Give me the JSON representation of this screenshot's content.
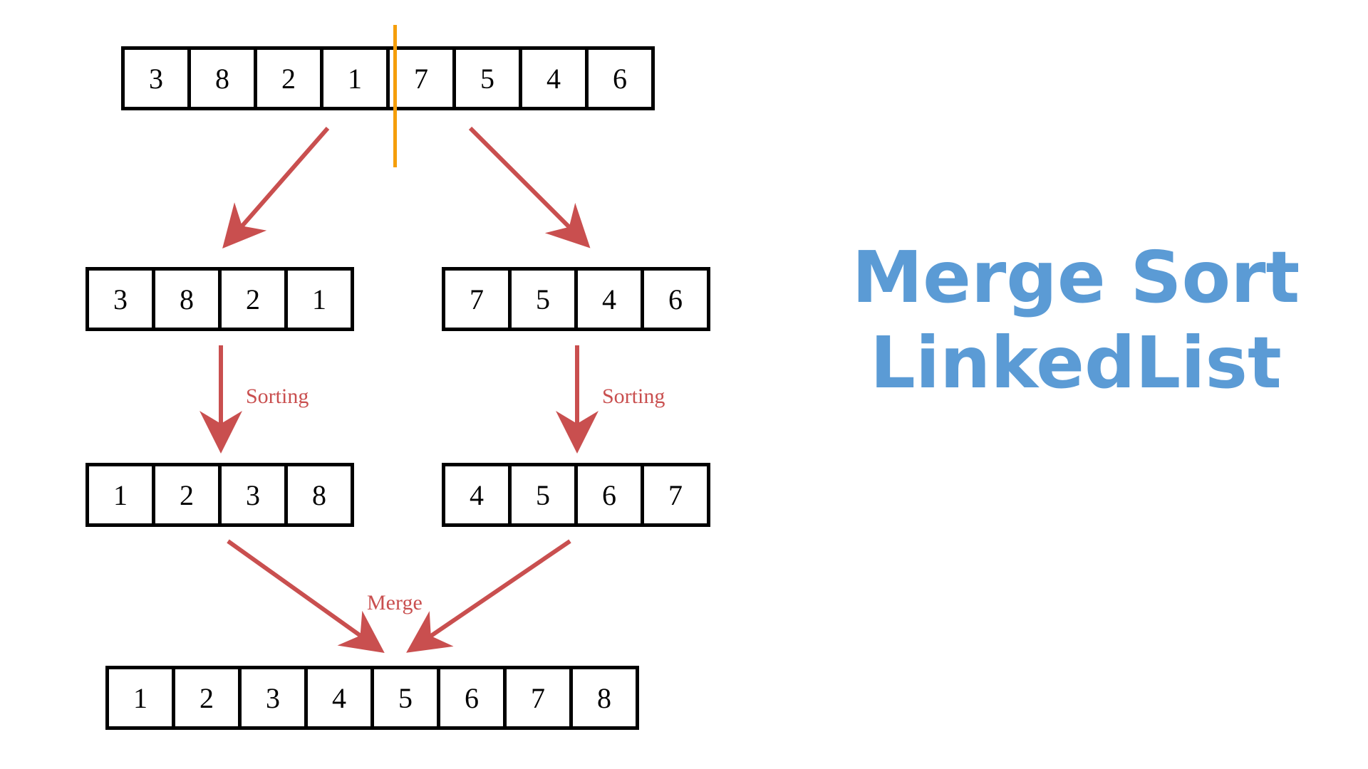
{
  "title_line1": "Merge Sort",
  "title_line2": "LinkedList",
  "labels": {
    "sorting_left": "Sorting",
    "sorting_right": "Sorting",
    "merge": "Merge"
  },
  "rows": {
    "top": [
      "3",
      "8",
      "2",
      "1",
      "7",
      "5",
      "4",
      "6"
    ],
    "split_left": [
      "3",
      "8",
      "2",
      "1"
    ],
    "split_right": [
      "7",
      "5",
      "4",
      "6"
    ],
    "sorted_left": [
      "1",
      "2",
      "3",
      "8"
    ],
    "sorted_right": [
      "4",
      "5",
      "6",
      "7"
    ],
    "merged": [
      "1",
      "2",
      "3",
      "4",
      "5",
      "6",
      "7",
      "8"
    ]
  },
  "colors": {
    "arrow": "#c94f4f",
    "divider": "#f59e0b",
    "title": "#5b9bd5"
  }
}
